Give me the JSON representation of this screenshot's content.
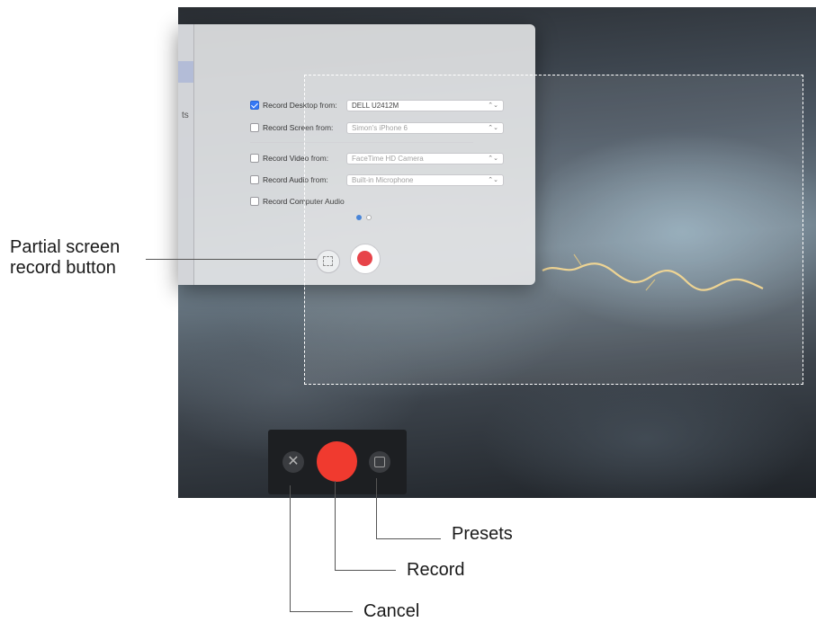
{
  "window": {
    "sidebar_fragment": "ts",
    "options": [
      {
        "label": "Record Desktop from:",
        "value": "DELL U2412M",
        "checked": true
      },
      {
        "label": "Record Screen from:",
        "value": "Simon's iPhone 6",
        "checked": false
      },
      {
        "label": "Record Video from:",
        "value": "FaceTime HD Camera",
        "checked": false
      },
      {
        "label": "Record Audio from:",
        "value": "Built-in Microphone",
        "checked": false
      },
      {
        "label": "Record Computer Audio",
        "checked": false
      }
    ],
    "select_arrows": "⌃⌄"
  },
  "control_bar": {
    "cancel_glyph": "✕"
  },
  "callouts": {
    "partial_line1": "Partial screen",
    "partial_line2": "record button",
    "presets": "Presets",
    "record": "Record",
    "cancel": "Cancel"
  },
  "colors": {
    "record_red": "#f03a2f",
    "checkbox_blue": "#3478f6",
    "control_bar_bg": "#1d1f22"
  }
}
